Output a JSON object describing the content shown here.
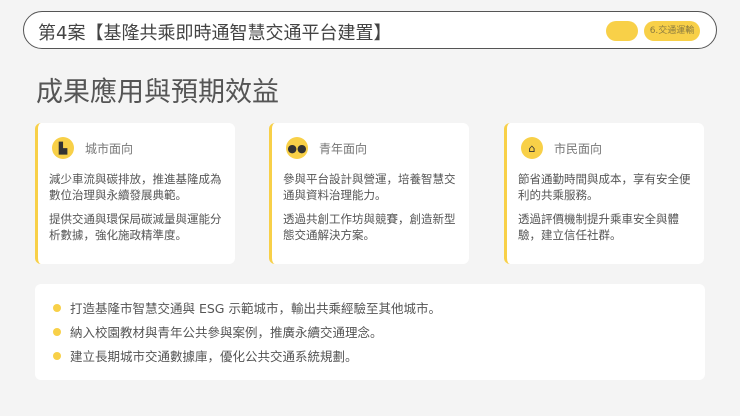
{
  "header": {
    "title": "第4案【基隆共乘即時通智慧交通平台建置】",
    "tag": "6.交通運輸"
  },
  "heading": "成果應用與預期效益",
  "cards": [
    {
      "icon": "city-icon",
      "label": "城市面向",
      "p1": "減少車流與碳排放，推進基隆成為數位治理與永續發展典範。",
      "p2": "提供交通與環保局碳減量與運能分析數據，強化施政精準度。"
    },
    {
      "icon": "group-icon",
      "label": "青年面向",
      "p1": "參與平台設計與營運，培養智慧交通與資料治理能力。",
      "p2": "透過共創工作坊與競賽，創造新型態交通解決方案。"
    },
    {
      "icon": "home-icon",
      "label": "市民面向",
      "p1": "節省通勤時間與成本，享有安全便利的共乘服務。",
      "p2": "透過評價機制提升乘車安全與體驗，建立信任社群。"
    }
  ],
  "bullets": [
    "打造基隆市智慧交通與 ESG 示範城市，輸出共乘經驗至其他城市。",
    "納入校園教材與青年公共參與案例，推廣永續交通理念。",
    "建立長期城市交通數據庫，優化公共交通系統規劃。"
  ],
  "colors": {
    "accent": "#f8d048"
  }
}
